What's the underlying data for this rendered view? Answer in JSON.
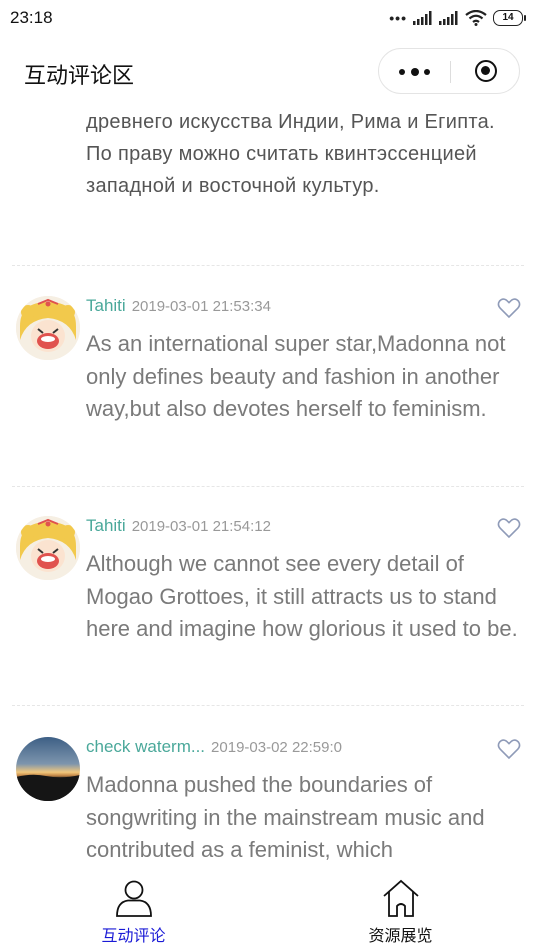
{
  "status_bar": {
    "time": "23:18",
    "signal_dots": "•••",
    "battery": "14"
  },
  "nav": {
    "title": "互动评论区"
  },
  "top_comment_text": "древнего искусства Индии, Рима и Египта. По праву можно считать квинтэссенцией западной и восточной культур.",
  "comments": [
    {
      "username": "Tahiti",
      "timestamp": "2019-03-01 21:53:34",
      "text": "As an international super star,Madonna not only defines beauty and fashion in another way,but also devotes herself to feminism.",
      "avatar": "sailor-moon-avatar"
    },
    {
      "username": "Tahiti",
      "timestamp": "2019-03-01 21:54:12",
      "text": "Although we cannot see every detail of Mogao Grottoes, it still attracts us to stand here and imagine how glorious it used to be.",
      "avatar": "sailor-moon-avatar"
    },
    {
      "username": "check waterm...",
      "timestamp": "2019-03-02 22:59:0",
      "text": "Madonna pushed the boundaries of songwriting in the mainstream music and contributed as a feminist, which",
      "avatar": "sunset-avatar"
    }
  ],
  "tabs": [
    {
      "label": "互动评论",
      "icon": "person-icon",
      "active": true,
      "color": "#1a1ad6"
    },
    {
      "label": "资源展览",
      "icon": "home-icon",
      "active": false,
      "color": "#111111"
    }
  ],
  "colors": {
    "username": "#4aa89a",
    "timestamp": "#999999",
    "comment_text": "#7a7a7a",
    "heart": "#8f9bb8",
    "active_tab": "#1a1ad6"
  }
}
